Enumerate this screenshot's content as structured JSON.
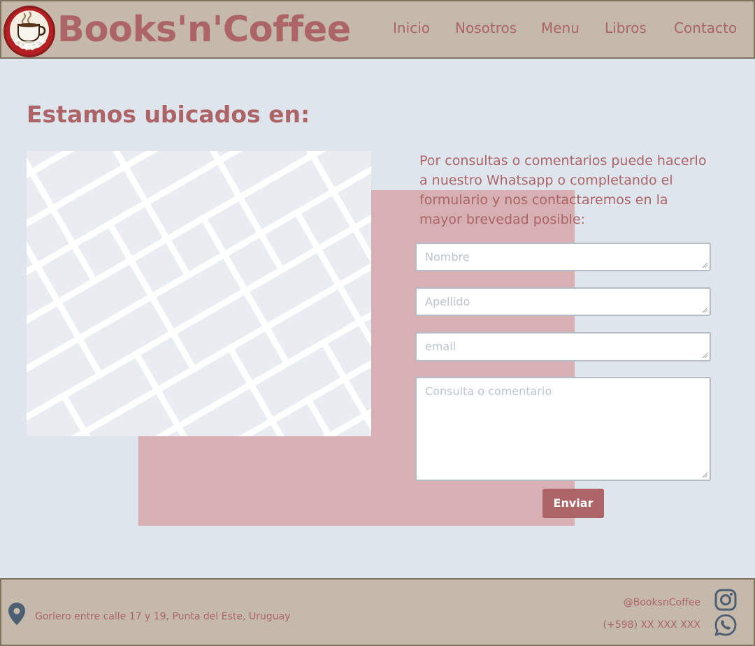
{
  "header": {
    "brand": "Books'n'Coffee",
    "logo_text": "COFFEE",
    "nav": [
      "Inicio",
      "Nosotros",
      "Menu",
      "Libros",
      "Contacto"
    ]
  },
  "main": {
    "title": "Estamos ubicados en:",
    "intro": "Por consultas o comentarios puede hacerlo a nuestro Whatsapp o completando el formulario y nos contactaremos en la mayor brevedad posible:",
    "form": {
      "nombre_placeholder": "Nombre",
      "apellido_placeholder": "Apellido",
      "email_placeholder": "email",
      "consulta_placeholder": "Consulta o comentario",
      "submit_label": "Enviar"
    }
  },
  "footer": {
    "address": "Gorlero entre calle 17 y 19, Punta del Este, Uruguay",
    "instagram": "@BooksnCoffee",
    "whatsapp": "(+598) XX XXX XXX"
  },
  "icons": {
    "logo": "coffee-cup-logo",
    "location": "location-pin-icon",
    "instagram": "instagram-icon",
    "whatsapp": "whatsapp-icon"
  },
  "colors": {
    "accent": "#ac6466",
    "header_bg": "#c4b9ab",
    "page_bg": "#dfe5ed",
    "pink_block": "#d6b0b2",
    "icon_slate": "#4d5f73"
  }
}
